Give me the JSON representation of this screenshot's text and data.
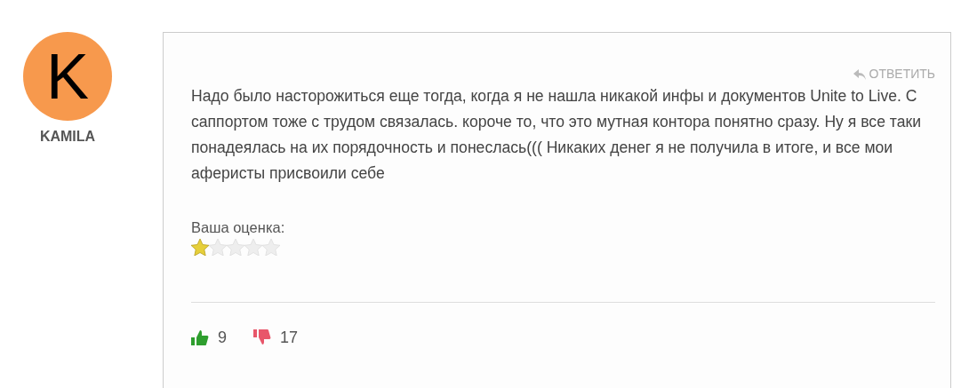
{
  "author": {
    "initial": "K",
    "name": "KAMILA"
  },
  "comment": {
    "reply_label": "ОТВЕТИТЬ",
    "text": "Надо было насторожиться еще тогда, когда я не нашла никакой инфы и документов Unite to Live. С саппортом тоже с трудом связалась. короче то, что это мутная контора понятно сразу. Ну я все таки понадеялась на их порядочность и понеслась((( Никаких денег я не получила в итоге, и все мои аферисты присвоили себе",
    "rating_label": "Ваша оценка:",
    "stars": 1,
    "likes": "9",
    "dislikes": "17"
  }
}
